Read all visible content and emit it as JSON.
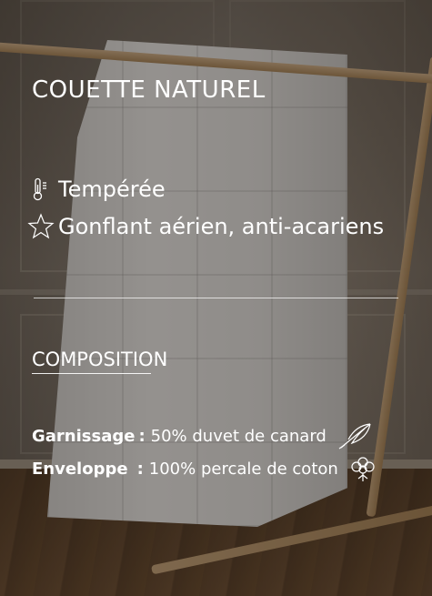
{
  "title": "COUETTE NATUREL",
  "features": [
    {
      "icon": "thermometer-icon",
      "label": "Tempérée"
    },
    {
      "icon": "star-icon",
      "label": "Gonflant aérien, anti-acariens"
    }
  ],
  "composition": {
    "heading": "COMPOSITION",
    "rows": [
      {
        "label": "Garnissage",
        "separator": ":",
        "value": "50% duvet de canard",
        "icon": "feather-icon"
      },
      {
        "label": "Enveloppe",
        "separator": ":",
        "value": "100% percale de coton",
        "icon": "cotton-flower-icon"
      }
    ]
  },
  "colors": {
    "text": "#ffffff",
    "overlay": "rgba(35,28,22,0.45)"
  }
}
